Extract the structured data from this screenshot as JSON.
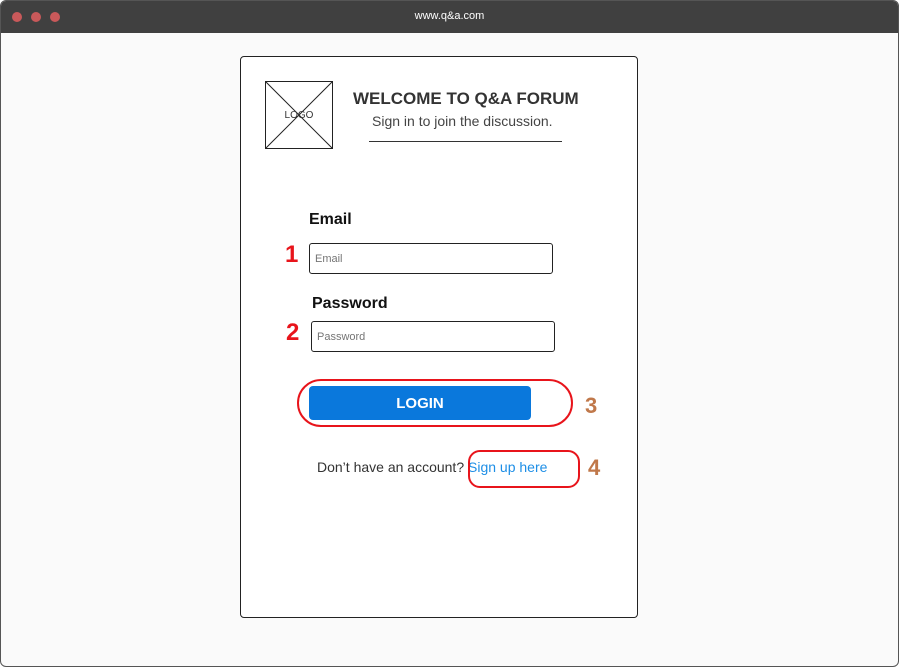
{
  "browser": {
    "url": "www.q&a.com"
  },
  "header": {
    "logo_text": "LOGO",
    "title": "WELCOME TO Q&A FORUM",
    "subtitle": "Sign in to join the discussion."
  },
  "form": {
    "email_label": "Email",
    "email_placeholder": "Email",
    "password_label": "Password",
    "password_placeholder": "Password",
    "login_label": "LOGIN",
    "signup_prompt": "Don’t have an account?",
    "signup_link": "Sign up here"
  },
  "annotations": [
    "1",
    "2",
    "3",
    "4"
  ],
  "colors": {
    "red": "#e8141b",
    "brown": "#c0784a",
    "primary": "#0a78dc"
  }
}
